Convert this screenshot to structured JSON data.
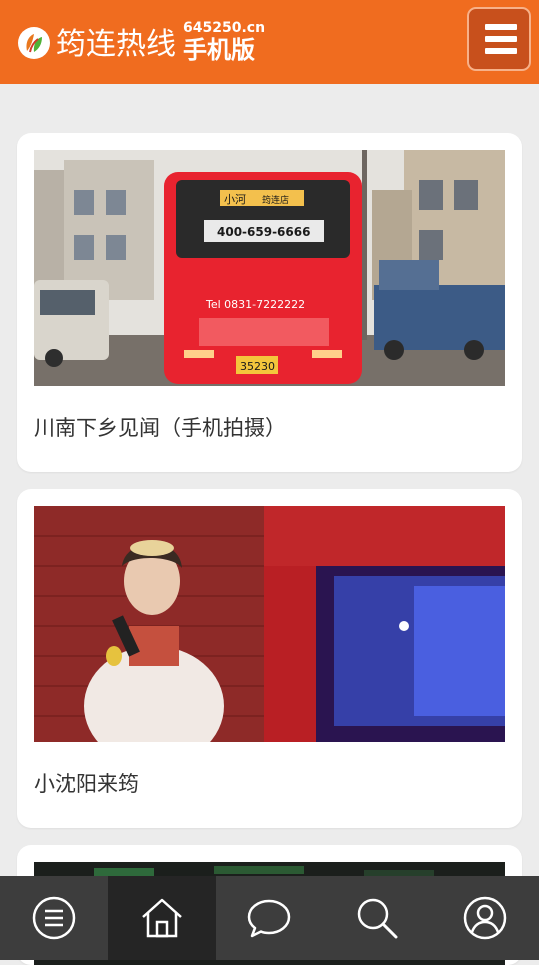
{
  "header": {
    "brand_name": "筠连热线",
    "brand_domain": "645250.cn",
    "brand_sub": "手机版",
    "logo_icon": "leaf-logo-icon",
    "menu_icon": "hamburger-menu-icon",
    "colors": {
      "bar": "#f06c1f",
      "menu_button": "#c8501c"
    }
  },
  "feed": {
    "items": [
      {
        "caption": "川南下乡见闻（手机拍摄）",
        "image": "red-bus-street-photo"
      },
      {
        "caption": "小沈阳来筠",
        "image": "singer-on-stage-photo"
      },
      {
        "caption": "",
        "image": "dark-stage-photo"
      }
    ]
  },
  "bus_photo": {
    "route_sign": "小河",
    "route_dest": "筠连店",
    "ad_phone": "400-659-6666",
    "tel": "Tel 0831-7222222",
    "plate": "35230"
  },
  "bottom_nav": {
    "items": [
      {
        "icon": "menu-circle-icon",
        "active": false
      },
      {
        "icon": "home-icon",
        "active": true
      },
      {
        "icon": "chat-bubble-icon",
        "active": false
      },
      {
        "icon": "search-icon",
        "active": false
      },
      {
        "icon": "user-icon",
        "active": false
      }
    ]
  }
}
